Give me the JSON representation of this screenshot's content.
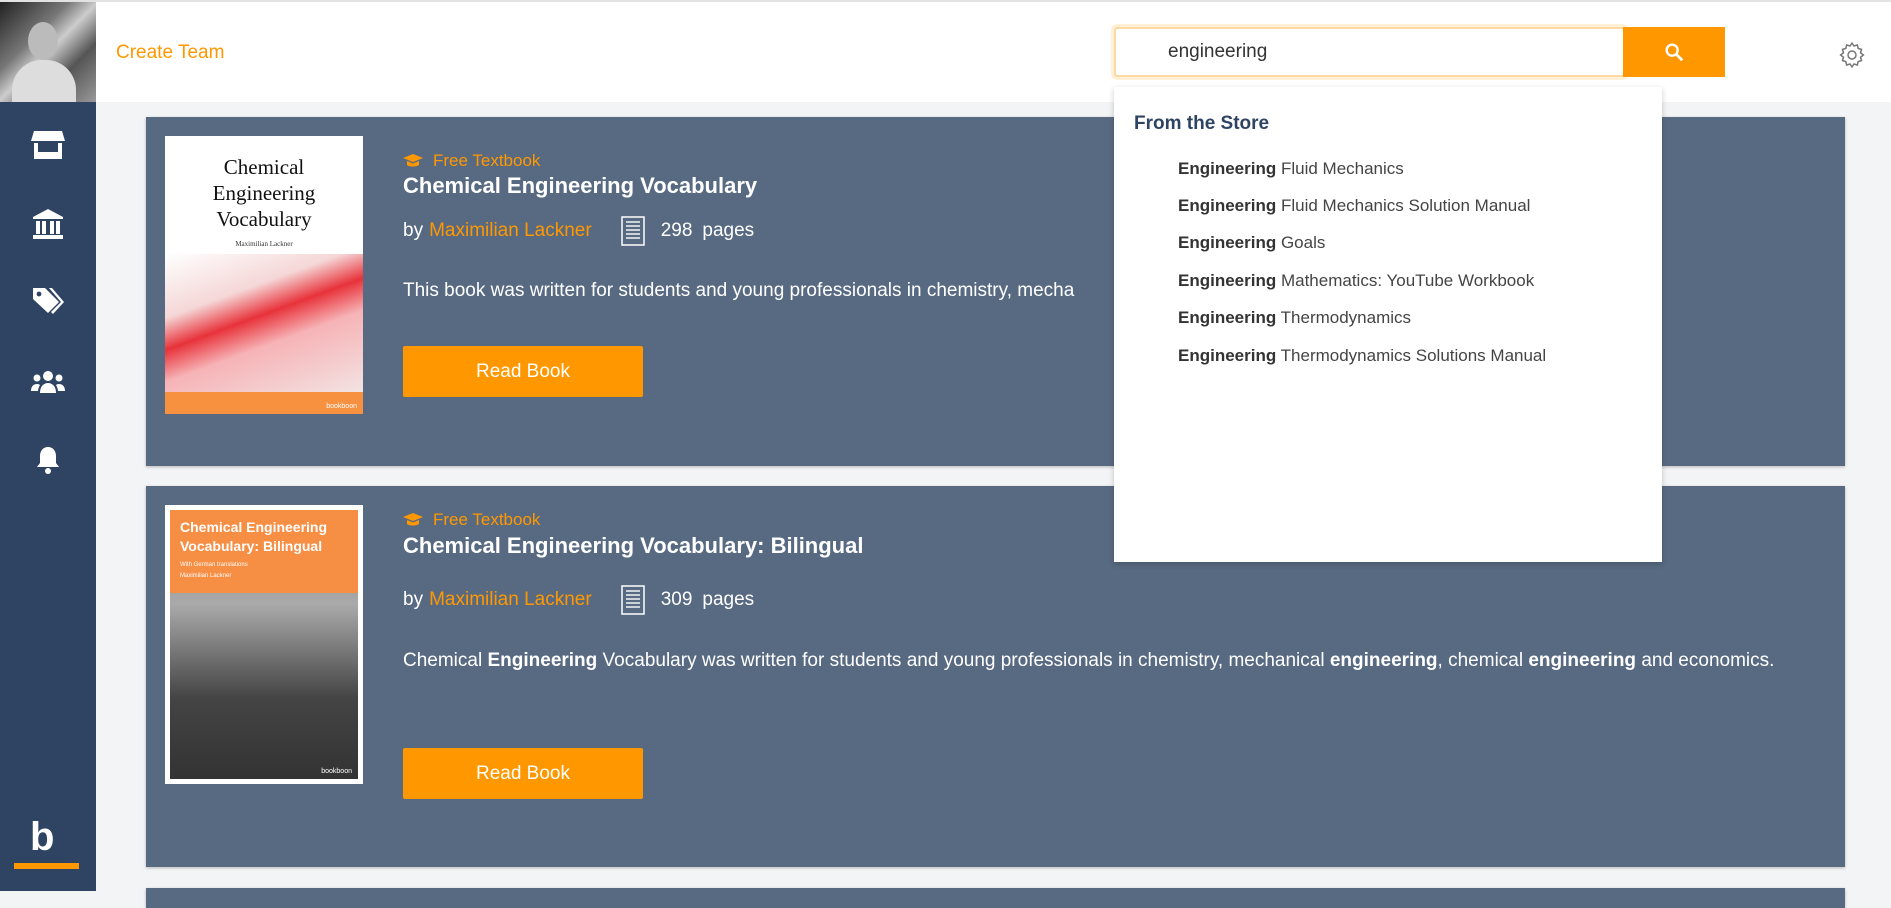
{
  "header": {
    "create_team": "Create Team",
    "search_value": "engineering",
    "search_icon": "magnifier-icon",
    "settings_icon": "gear-icon"
  },
  "sidebar": {
    "items": [
      {
        "name": "store",
        "icon": "storefront-icon"
      },
      {
        "name": "library",
        "icon": "bank-icon"
      },
      {
        "name": "tags",
        "icon": "tags-icon"
      },
      {
        "name": "teams",
        "icon": "users-icon"
      },
      {
        "name": "notifications",
        "icon": "bell-icon"
      }
    ],
    "logo": "b"
  },
  "colors": {
    "accent": "#ff9800",
    "sidebar": "#2f4463",
    "card": "#586a82"
  },
  "books": [
    {
      "badge": "Free Textbook",
      "title": "Chemical Engineering Vocabulary",
      "by": "by",
      "author": "Maximilian Lackner",
      "pages": "298",
      "pages_label": "pages",
      "description": "This book was written for students and young professionals in chemistry, mecha",
      "button": "Read Book",
      "cover": {
        "title": "Chemical Engineering Vocabulary",
        "author": "Maximilian Lackner",
        "publisher": "bookboon"
      }
    },
    {
      "badge": "Free Textbook",
      "title": "Chemical Engineering Vocabulary: Bilingual",
      "by": "by",
      "author": "Maximilian Lackner",
      "pages": "309",
      "pages_label": "pages",
      "description": [
        {
          "t": "Chemical ",
          "b": false
        },
        {
          "t": "Engineering",
          "b": true
        },
        {
          "t": " Vocabulary was written for students and young professionals in chemistry, mechanical ",
          "b": false
        },
        {
          "t": "engineering",
          "b": true
        },
        {
          "t": ", chemical ",
          "b": false
        },
        {
          "t": "engineering",
          "b": true
        },
        {
          "t": " and economics.",
          "b": false
        }
      ],
      "button": "Read Book",
      "cover": {
        "title_1": "Chemical Engineering",
        "title_2": "Vocabulary: Bilingual",
        "subtitle": "With German translations",
        "author": "Maximilian Lackner",
        "publisher": "bookboon"
      }
    }
  ],
  "dropdown": {
    "heading": "From the Store",
    "items": [
      {
        "bold": "Engineering",
        "rest": " Fluid Mechanics"
      },
      {
        "bold": "Engineering",
        "rest": " Fluid Mechanics Solution Manual"
      },
      {
        "bold": "Engineering",
        "rest": " Goals"
      },
      {
        "bold": "Engineering",
        "rest": " Mathematics: YouTube Workbook"
      },
      {
        "bold": "Engineering",
        "rest": " Thermodynamics"
      },
      {
        "bold": "Engineering",
        "rest": " Thermodynamics Solutions Manual"
      }
    ]
  }
}
